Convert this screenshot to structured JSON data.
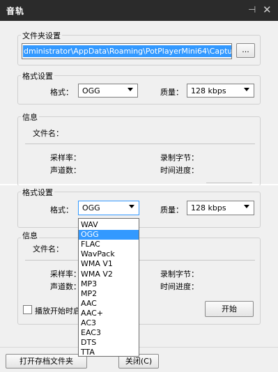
{
  "window": {
    "title": "音轨",
    "pin_icon": "⊣",
    "close_icon": "✕"
  },
  "folder_settings": {
    "group_label": "文件夹设置",
    "path": "dministrator\\AppData\\Roaming\\PotPlayerMini64\\Capture",
    "browse_label": "..."
  },
  "format_settings": {
    "group_label": "格式设置",
    "format_label": "格式：",
    "format_value": "OGG",
    "quality_label": "质量：",
    "quality_value": "128 kbps"
  },
  "info": {
    "group_label": "信息",
    "filename_label": "文件名：",
    "sample_rate_label": "采样率：",
    "recorded_bytes_label": "录制字节：",
    "channels_label": "声道数：",
    "time_progress_label": "时间进度："
  },
  "record": {
    "checkbox_label": "播放开始时启",
    "start_label": "开始"
  },
  "footer": {
    "open_folder_label": "打开存档文件夹",
    "close_label": "关闭(C)"
  },
  "dropdown": {
    "options": [
      "WAV",
      "OGG",
      "FLAC",
      "WavPack",
      "WMA V1",
      "WMA V2",
      "MP3",
      "MP2",
      "AAC",
      "AAC+",
      "AC3",
      "EAC3",
      "DTS",
      "TTA"
    ],
    "selected_index": 1
  }
}
